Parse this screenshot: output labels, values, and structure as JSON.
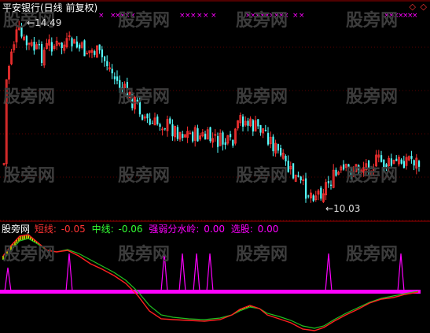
{
  "price_panel": {
    "title": "平安银行(日线 前复权)",
    "high_label": "14.49",
    "low_label": "10.03",
    "high_arrow": "←",
    "low_arrow": "←"
  },
  "indicator_panel": {
    "name": "股旁网",
    "items": [
      {
        "label": "短线:",
        "value": "-0.05",
        "color": "#ff3333"
      },
      {
        "label": "中线:",
        "value": "-0.06",
        "color": "#33ff33"
      },
      {
        "label": "强弱分水岭:",
        "value": "0.00",
        "color": "#ff00ff"
      },
      {
        "label": "选股:",
        "value": "0.00",
        "color": "#ff00ff"
      }
    ]
  },
  "watermark": "股旁网",
  "colors": {
    "up": "#ff3232",
    "down": "#54ffff",
    "grid": "#a00000",
    "short_line": "#ff2020",
    "mid_line": "#20c020",
    "baseline": "#ff00ff",
    "fill": "#ffff00",
    "signal": "#ff00ff"
  },
  "icons": {
    "corner": "diamond-icon",
    "marker": "cross-mark-icon"
  }
}
